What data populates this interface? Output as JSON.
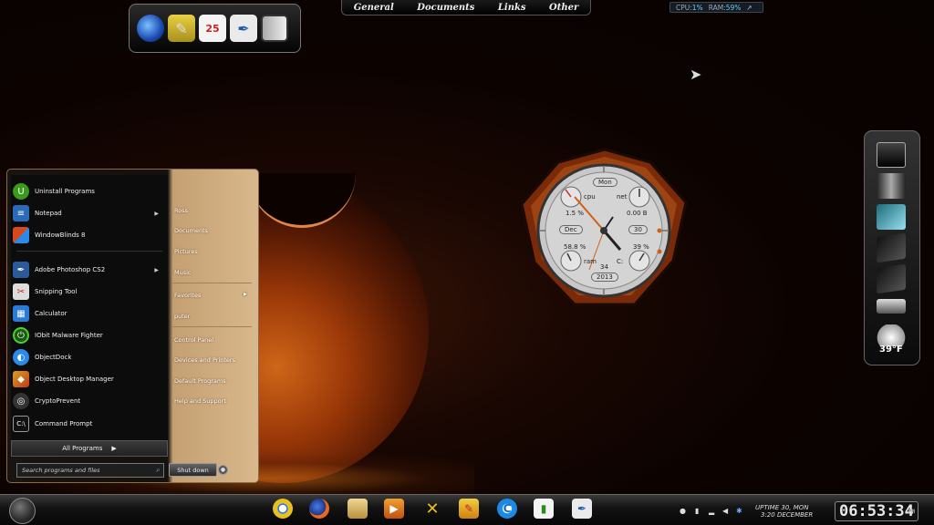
{
  "top_tabs": [
    "General",
    "Documents",
    "Links",
    "Other"
  ],
  "system_meter": {
    "cpu_label": "CPU:",
    "cpu_value": "1%",
    "ram_label": "RAM:",
    "ram_value": "59%",
    "arrow": "↗"
  },
  "top_dock": [
    "google-earth-icon",
    "paint-bucket-icon",
    "calendar-icon",
    "feather-icon",
    "book-icon"
  ],
  "top_dock_calendar_day": "25",
  "start_menu": {
    "pinned": [
      {
        "label": "Uninstall Programs",
        "icon": "uninstall-icon",
        "color": "#3a9a1a"
      },
      {
        "label": "Notepad",
        "icon": "notepad-icon",
        "color": "#2a6ab8",
        "submenu": true
      },
      {
        "label": "WindowBlinds 8",
        "icon": "windowblinds-icon",
        "color": "#d84a1a"
      }
    ],
    "recent": [
      {
        "label": "Adobe Photoshop CS2",
        "icon": "photoshop-icon",
        "color": "#2a5a9a",
        "submenu": true
      },
      {
        "label": "Snipping Tool",
        "icon": "scissors-icon",
        "color": "#c83030"
      },
      {
        "label": "Calculator",
        "icon": "calculator-icon",
        "color": "#2a7ad8"
      },
      {
        "label": "IObit Malware Fighter",
        "icon": "iobit-icon",
        "color": "#3a9a1a"
      },
      {
        "label": "ObjectDock",
        "icon": "objectdock-icon",
        "color": "#2a8ae8"
      },
      {
        "label": "Object Desktop Manager",
        "icon": "object-desktop-icon",
        "color": "#d8a020"
      },
      {
        "label": "CryptoPrevent",
        "icon": "cryptoprevent-icon",
        "color": "#444"
      },
      {
        "label": "Command Prompt",
        "icon": "cmd-icon",
        "color": "#222"
      }
    ],
    "all_programs": "All Programs",
    "search_placeholder": "Search programs and files",
    "right_group1": [
      "Ross",
      "Documents",
      "Pictures",
      "Music"
    ],
    "right_group2": [
      "Favorites",
      "puter"
    ],
    "right_group3": [
      "Control Panel",
      "Devices and Printers",
      "Default Programs",
      "Help and Support"
    ],
    "shutdown": "Shut down"
  },
  "gadget": {
    "day": "Mon",
    "cpu_label": "cpu",
    "net_label": "net",
    "cpu_value": "1.5 %",
    "net_value": "0.00 B",
    "month": "Dec",
    "date": "30",
    "ram_pct": "58.8 %",
    "disk_pct": "39 %",
    "ram_label": "ram",
    "disk_label": "C:",
    "minute": "34",
    "year": "2013"
  },
  "side_dock": {
    "temperature": "39°F"
  },
  "taskbar": {
    "apps": [
      "chrome-icon",
      "firefox-icon",
      "explorer-icon",
      "media-player-icon",
      "tools-icon",
      "paint-icon",
      "ccleaner-icon",
      "taskmgr-icon",
      "feather-icon"
    ],
    "uptime_line1": "UPTIME  30, MON",
    "uptime_line2": "3:20  DECEMBER",
    "clock": "06:53:34",
    "ampm": "PM"
  }
}
